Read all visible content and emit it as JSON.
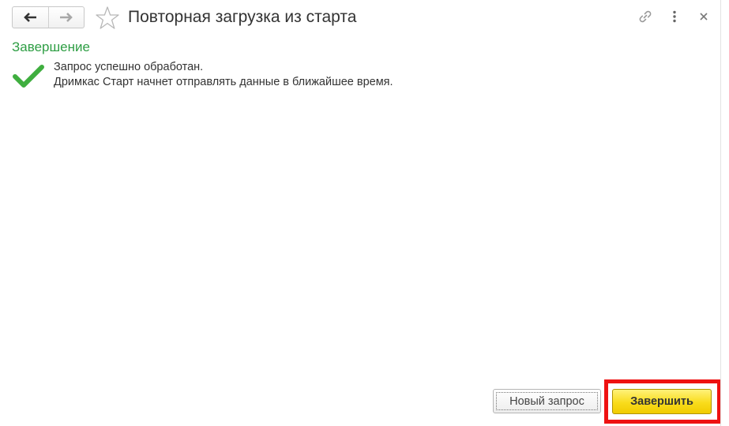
{
  "header": {
    "back_icon": "arrow-left-icon",
    "forward_icon": "arrow-right-icon",
    "favorite_icon": "star-icon",
    "title": "Повторная загрузка из старта",
    "link_icon": "link-icon",
    "more_icon": "more-vertical-icon",
    "close_label": "×"
  },
  "content": {
    "section_title": "Завершение",
    "status_icon": "checkmark-icon",
    "message_line1": "Запрос успешно обработан.",
    "message_line2": "Дримкас Старт начнет отправлять данные в ближайшее время."
  },
  "footer": {
    "new_request_label": "Новый запрос",
    "finish_label": "Завершить"
  },
  "colors": {
    "section_title": "#2e9e44",
    "checkmark": "#3fae3f",
    "primary_button": "#f9dc1c",
    "highlight": "#ee1111"
  }
}
